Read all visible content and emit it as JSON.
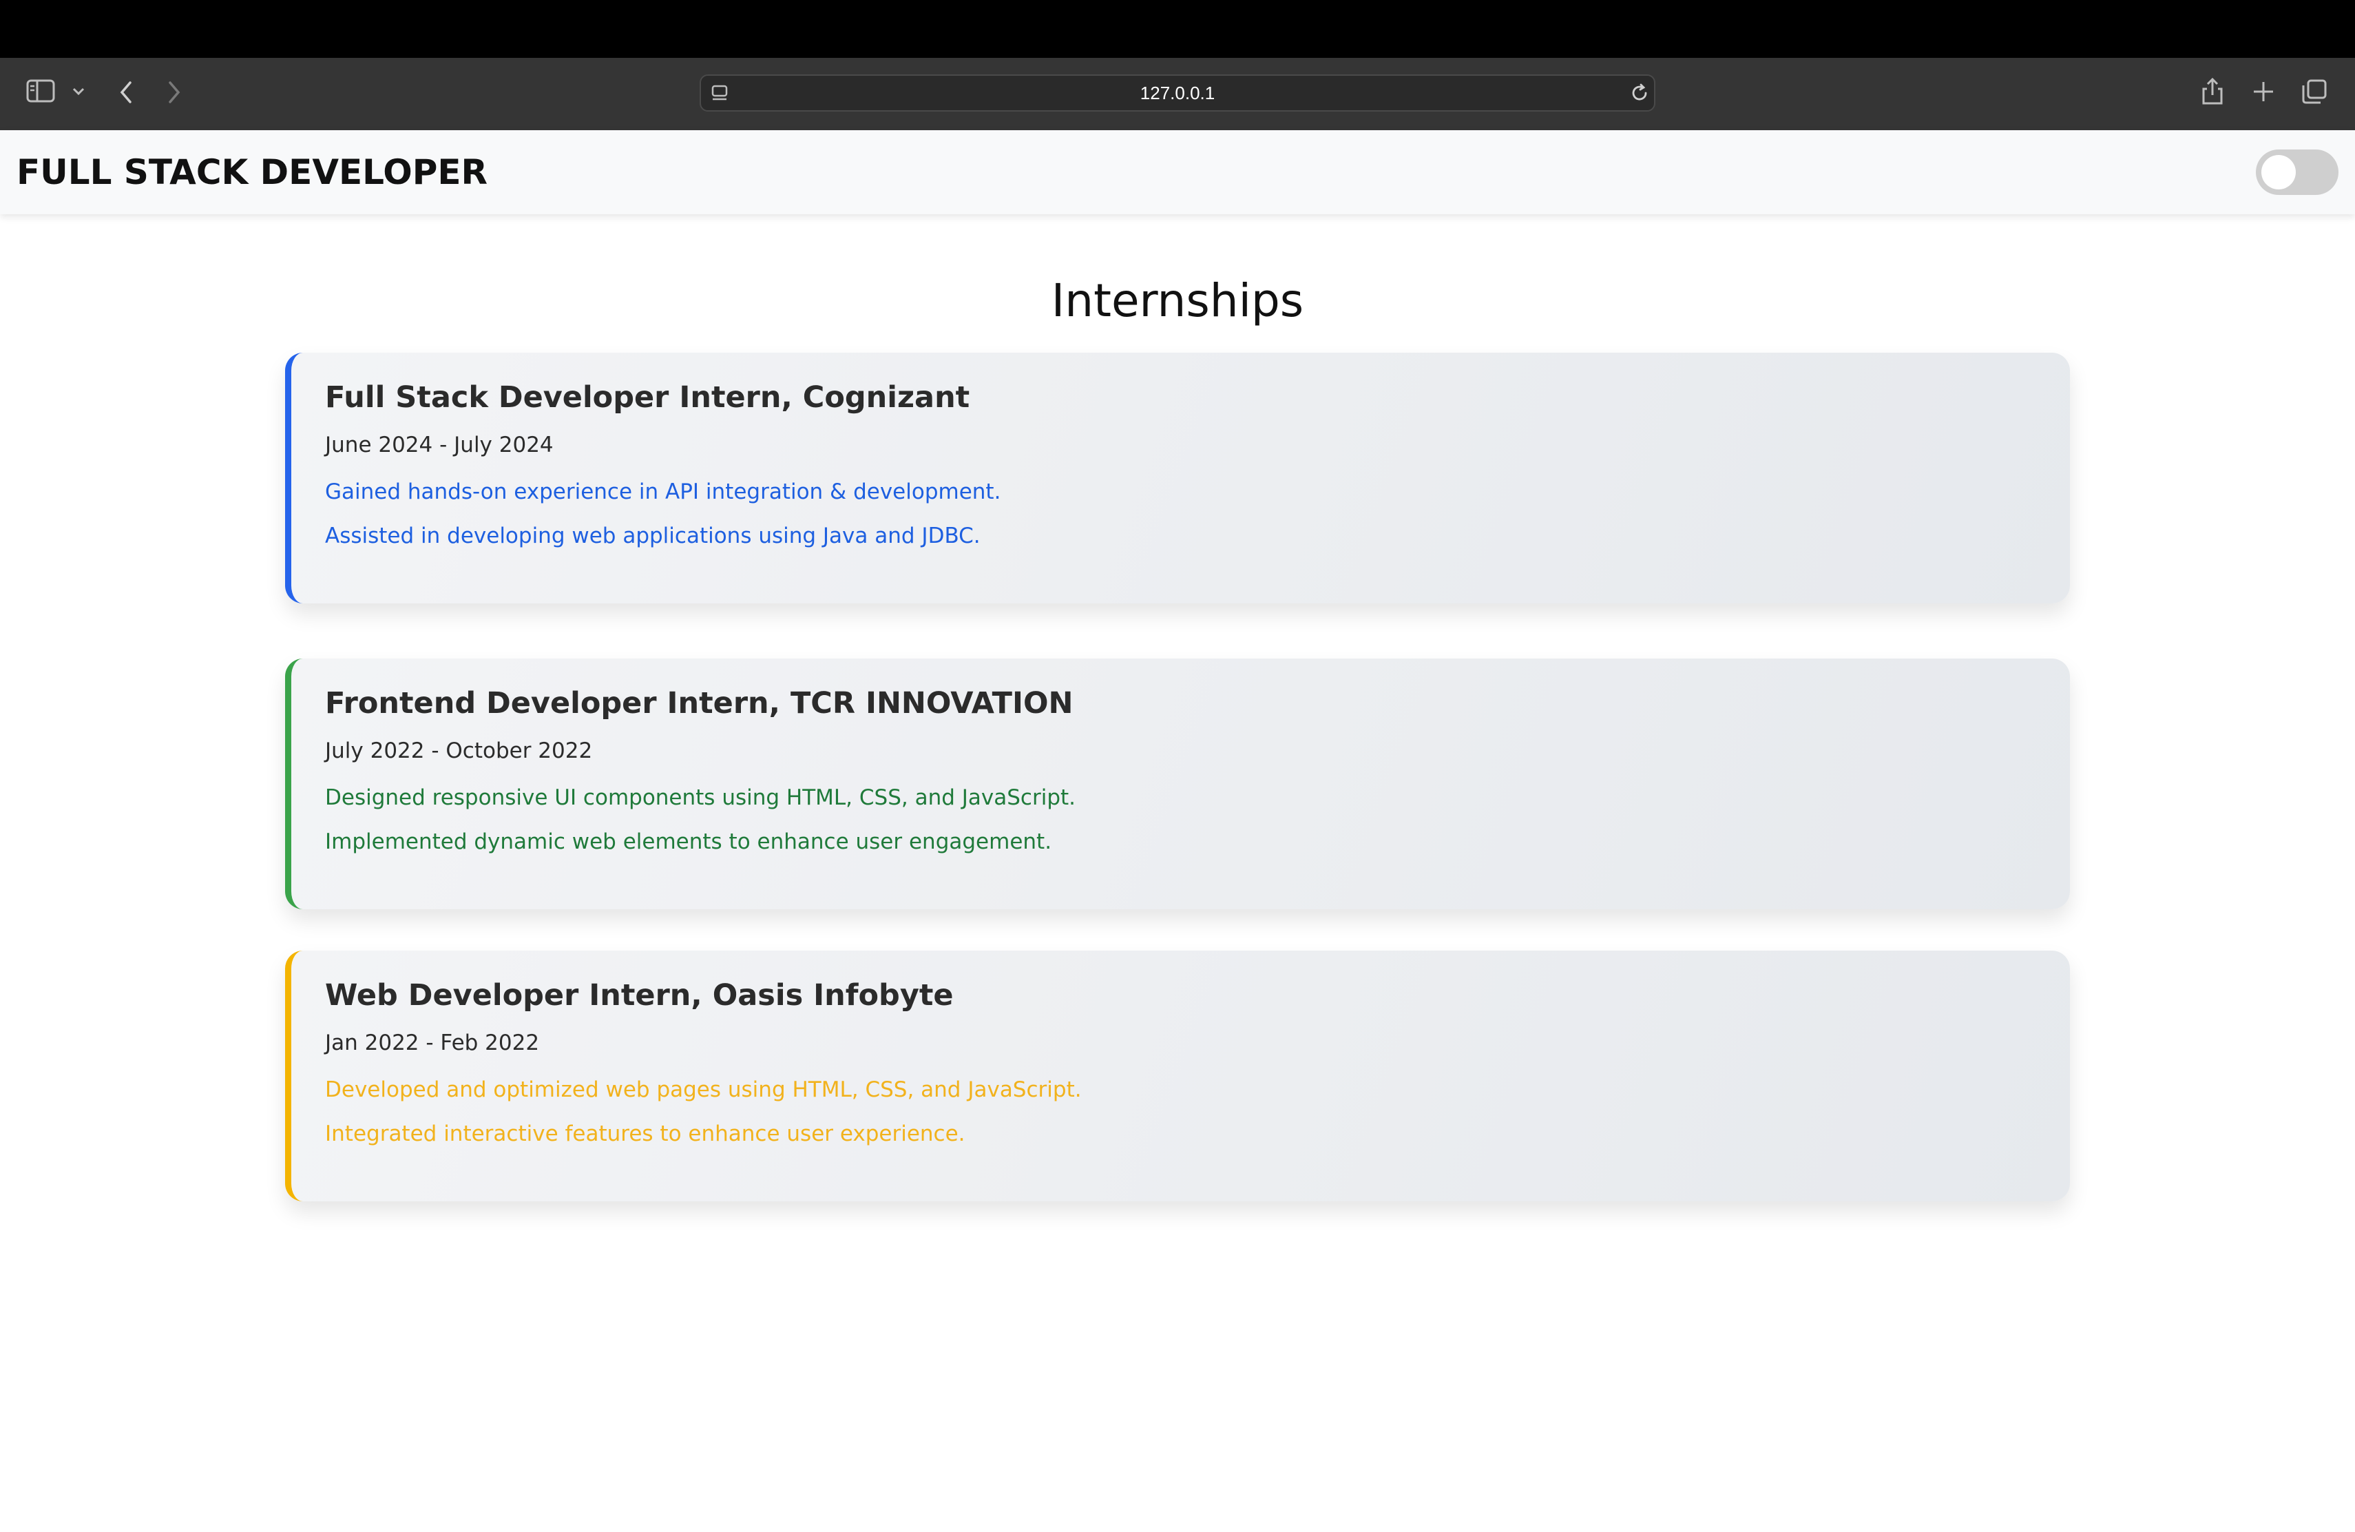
{
  "browser": {
    "url": "127.0.0.1"
  },
  "header": {
    "title": "FULL STACK DEVELOPER"
  },
  "main": {
    "section_title": "Internships",
    "internships": [
      {
        "title": "Full Stack Developer Intern, Cognizant",
        "dates": "June 2024 - July 2024",
        "points": [
          "Gained hands-on experience in API integration & development.",
          "Assisted in developing web applications using Java and JDBC."
        ],
        "accent": "#2563eb",
        "text_color": "#1d5fe0"
      },
      {
        "title": "Frontend Developer Intern, TCR INNOVATION",
        "dates": "July 2022 - October 2022",
        "points": [
          "Designed responsive UI components using HTML, CSS, and JavaScript.",
          "Implemented dynamic web elements to enhance user engagement."
        ],
        "accent": "#3aa34a",
        "text_color": "#1f7a3a"
      },
      {
        "title": "Web Developer Intern, Oasis Infobyte",
        "dates": "Jan 2022 - Feb 2022",
        "points": [
          "Developed and optimized web pages using HTML, CSS, and JavaScript.",
          "Integrated interactive features to enhance user experience."
        ],
        "accent": "#f4b400",
        "text_color": "#f2b21c"
      }
    ]
  }
}
